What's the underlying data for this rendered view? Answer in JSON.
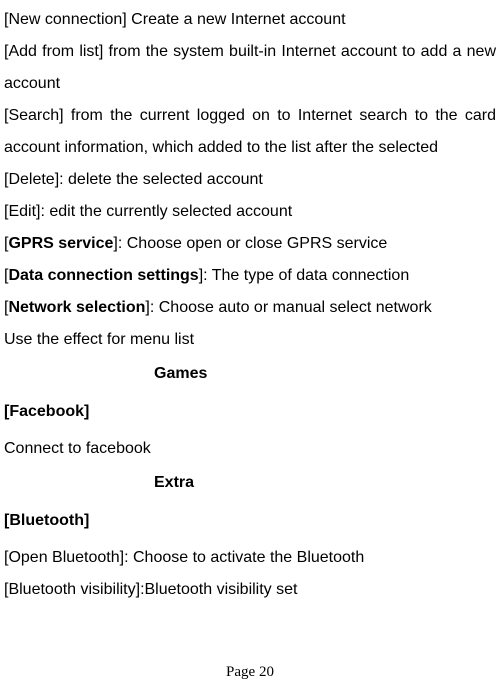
{
  "items": {
    "new_connection": {
      "label": "[New connection]",
      "desc": " Create a new Internet account"
    },
    "add_from_list": {
      "label": "[Add from list]",
      "desc": " from the system built-in Internet account to add a new account"
    },
    "search": {
      "label": "[Search]",
      "desc": " from the current logged on to Internet search to the card account information, which added to the list after the selected"
    },
    "delete": {
      "label": "[Delete]",
      "desc": ": delete the selected account"
    },
    "edit": {
      "label": "[Edit]",
      "desc": ": edit the currently selected account"
    },
    "gprs": {
      "open": "[",
      "label": "GPRS service",
      "close": "]",
      "desc": ": Choose open or close GPRS service"
    },
    "data_conn": {
      "open": "[",
      "label": "Data connection settings",
      "close": "]",
      "desc": ": The type of data connection"
    },
    "net_sel": {
      "open": "[",
      "label": "Network selection",
      "close": "]",
      "desc": ": Choose auto or manual select network"
    }
  },
  "effect_line": "Use the effect for menu list",
  "sections": {
    "games": "Games",
    "games_items": {
      "facebook": {
        "label": "[Facebook]",
        "desc": "Connect to facebook"
      }
    },
    "extra": "Extra",
    "extra_items": {
      "bluetooth": {
        "label": "[Bluetooth]"
      },
      "open_bluetooth": {
        "label": "[Open Bluetooth]",
        "desc": ": Choose to activate the Bluetooth"
      },
      "bt_visibility": {
        "label": "[Bluetooth visibility]",
        "desc": ":Bluetooth visibility set"
      }
    }
  },
  "page_number": "Page 20"
}
